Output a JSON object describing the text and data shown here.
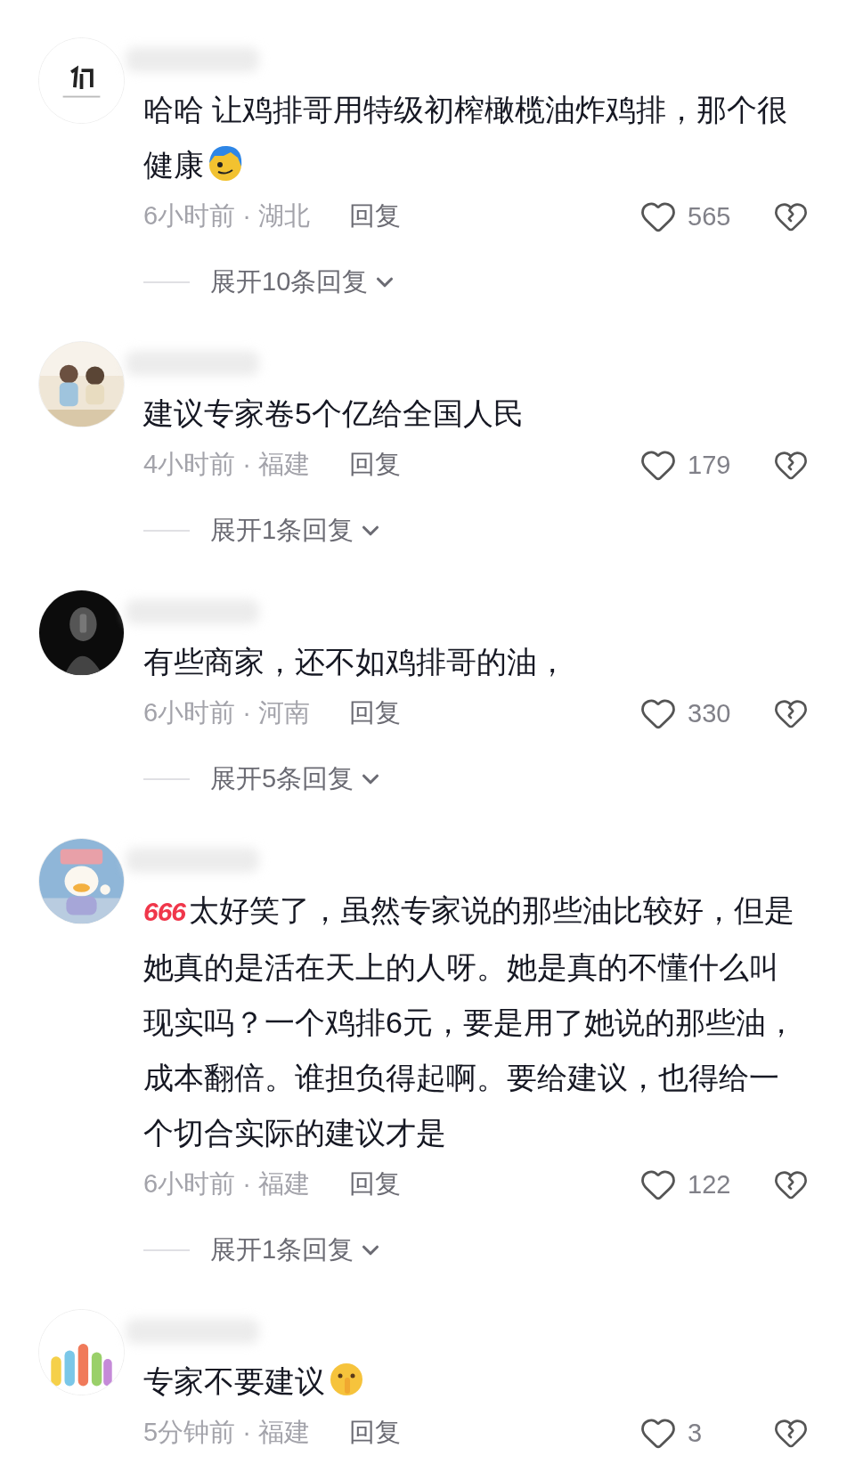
{
  "comments": [
    {
      "text": "哈哈 让鸡排哥用特级初榨橄榄油炸鸡排，那个很健康",
      "sticker": {
        "kind": "cartoon"
      },
      "meta": "6小时前 · 湖北",
      "reply": "回复",
      "likes": "565",
      "replies_toggle": "展开10条回复"
    },
    {
      "text": "建议专家卷5个亿给全国人民",
      "meta": "4小时前 · 福建",
      "reply": "回复",
      "likes": "179",
      "replies_toggle": "展开1条回复"
    },
    {
      "text": "有些商家，还不如鸡排哥的油，",
      "meta": "6小时前 · 河南",
      "reply": "回复",
      "likes": "330",
      "replies_toggle": "展开5条回复"
    },
    {
      "badge": "666",
      "text": "太好笑了，虽然专家说的那些油比较好，但是她真的是活在天上的人呀。她是真的不懂什么叫现实吗？一个鸡排6元，要是用了她说的那些油，成本翻倍。谁担负得起啊。要给建议，也得给一个切合实际的建议才是",
      "meta": "6小时前 · 福建",
      "reply": "回复",
      "likes": "122",
      "replies_toggle": "展开1条回复"
    },
    {
      "text": "专家不要建议",
      "sticker": {
        "kind": "shush"
      },
      "meta": "5分钟前 · 福建",
      "reply": "回复",
      "likes": "3"
    }
  ]
}
